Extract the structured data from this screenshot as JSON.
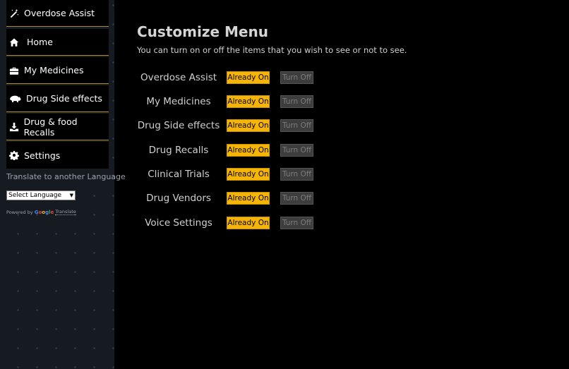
{
  "sidebar": {
    "items": [
      {
        "label": "Overdose Assist",
        "icon": "magic-wand-icon"
      },
      {
        "label": "Home",
        "icon": "home-icon"
      },
      {
        "label": "My Medicines",
        "icon": "medicine-kit-icon"
      },
      {
        "label": "Drug Side effects",
        "icon": "hippo-icon"
      },
      {
        "label": "Drug & food Recalls",
        "icon": "download-icon"
      },
      {
        "label": "Settings",
        "icon": "gear-icon"
      }
    ],
    "translate_label": "Translate to another Language",
    "language_select": "Select Language",
    "powered_by": "Powered by",
    "google": "Google",
    "translate_link": "Translate"
  },
  "main": {
    "title": "Customize Menu",
    "subtitle": "You can turn on or off the items that you wish to see or not to see.",
    "rows": [
      {
        "label": "Overdose Assist",
        "on_label": "Already On",
        "off_label": "Turn Off"
      },
      {
        "label": "My Medicines",
        "on_label": "Already On",
        "off_label": "Turn Off"
      },
      {
        "label": "Drug Side effects",
        "on_label": "Already On",
        "off_label": "Turn Off"
      },
      {
        "label": "Drug Recalls",
        "on_label": "Already On",
        "off_label": "Turn Off"
      },
      {
        "label": "Clinical Trials",
        "on_label": "Already On",
        "off_label": "Turn Off"
      },
      {
        "label": "Drug Vendors",
        "on_label": "Already On",
        "off_label": "Turn Off"
      },
      {
        "label": "Voice Settings",
        "on_label": "Already On",
        "off_label": "Turn Off"
      }
    ]
  },
  "colors": {
    "accent": "#f5b406",
    "sidebar_bg": "#161b22",
    "page_bg": "#000000",
    "separator": "#b08a1e"
  }
}
